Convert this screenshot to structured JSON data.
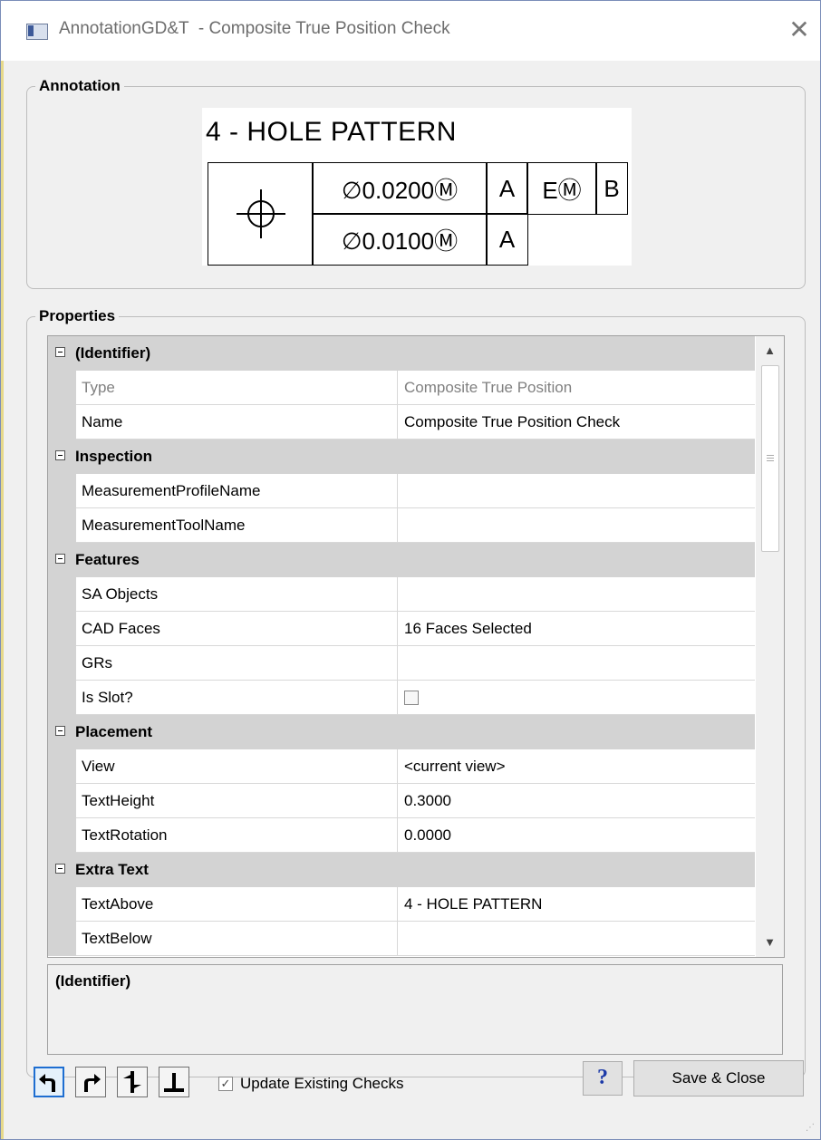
{
  "window": {
    "title": "AnnotationGD&T  - Composite True Position Check",
    "close_symbol": "✕",
    "app_icon": "window-app-icon"
  },
  "annotation": {
    "group_label": "Annotation",
    "text_above": "4 - HOLE PATTERN",
    "symbol_icon": "position-crosshair-icon",
    "row1": {
      "tolerance": "∅0.0200Ⓜ",
      "datum1": "A",
      "datum2": "EⓂ",
      "datum3": "B"
    },
    "row2": {
      "tolerance": "∅0.0100Ⓜ",
      "datum1": "A"
    }
  },
  "properties": {
    "group_label": "Properties",
    "categories": {
      "identifier": "(Identifier)",
      "inspection": "Inspection",
      "features": "Features",
      "placement": "Placement",
      "extra_text": "Extra Text"
    },
    "rows": {
      "type": {
        "name": "Type",
        "value": "Composite True Position"
      },
      "name": {
        "name": "Name",
        "value": "Composite True Position Check"
      },
      "measurement_profile": {
        "name": "MeasurementProfileName",
        "value": ""
      },
      "measurement_tool": {
        "name": "MeasurementToolName",
        "value": ""
      },
      "sa_objects": {
        "name": "SA Objects",
        "value": ""
      },
      "cad_faces": {
        "name": "CAD Faces",
        "value": "16 Faces Selected"
      },
      "grs": {
        "name": "GRs",
        "value": ""
      },
      "is_slot": {
        "name": "Is Slot?",
        "checked": false
      },
      "view": {
        "name": "View",
        "value": "<current view>"
      },
      "text_height": {
        "name": "TextHeight",
        "value": "0.3000"
      },
      "text_rotation": {
        "name": "TextRotation",
        "value": "0.0000"
      },
      "text_above": {
        "name": "TextAbove",
        "value": "4 - HOLE PATTERN"
      },
      "text_below": {
        "name": "TextBelow",
        "value": ""
      }
    },
    "description_title": "(Identifier)"
  },
  "footer": {
    "tool_buttons": [
      "arrow-up-left-icon",
      "arrow-up-right-icon",
      "vertical-cross-icon",
      "perpendicular-icon"
    ],
    "update_checks_label": "Update Existing Checks",
    "update_checks_checked": true,
    "help_label": "?",
    "save_label": "Save & Close"
  },
  "colors": {
    "category_row": "#d3d3d3",
    "readonly_text": "#808080",
    "active_button_border": "#1e6ed1",
    "help_glyph": "#1c3aa8"
  }
}
